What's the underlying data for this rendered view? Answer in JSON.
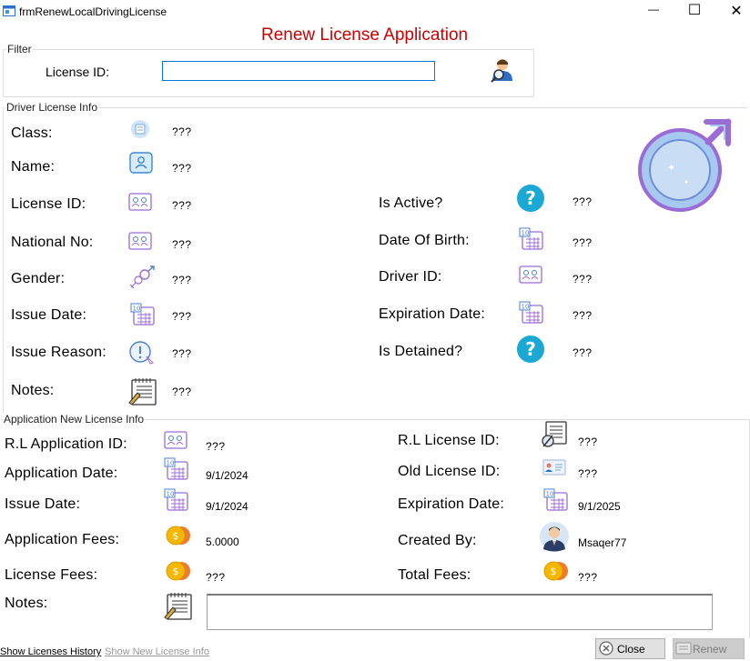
{
  "window": {
    "title": "frmRenewLocalDrivingLicense",
    "minimize": "—",
    "maximize": "☐",
    "close": "✕"
  },
  "form_title": "Renew License Application",
  "filter": {
    "caption": "Filter",
    "license_id_label": "License ID:",
    "license_id_value": ""
  },
  "driver_info": {
    "caption": "Driver License Info",
    "class": {
      "label": "Class:",
      "value": "???"
    },
    "name": {
      "label": "Name:",
      "value": "???"
    },
    "license_id": {
      "label": "License ID:",
      "value": "???"
    },
    "national_no": {
      "label": "National No:",
      "value": "???"
    },
    "gender": {
      "label": "Gender:",
      "value": "???"
    },
    "issue_date": {
      "label": "Issue Date:",
      "value": "???"
    },
    "issue_reason": {
      "label": "Issue Reason:",
      "value": "???"
    },
    "notes": {
      "label": "Notes:",
      "value": "???"
    },
    "is_active": {
      "label": "Is Active?",
      "value": "???"
    },
    "date_of_birth": {
      "label": "Date Of Birth:",
      "value": "???"
    },
    "driver_id": {
      "label": "Driver ID:",
      "value": "???"
    },
    "expiration_date": {
      "label": "Expiration Date:",
      "value": "???"
    },
    "is_detained": {
      "label": "Is Detained?",
      "value": "???"
    }
  },
  "application_info": {
    "caption": "Application New License Info",
    "rl_application_id": {
      "label": "R.L Application ID:",
      "value": "???"
    },
    "application_date": {
      "label": "Application Date:",
      "value": "9/1/2024"
    },
    "issue_date": {
      "label": "Issue Date:",
      "value": "9/1/2024"
    },
    "application_fees": {
      "label": "Application Fees:",
      "value": "5.0000"
    },
    "license_fees": {
      "label": "License Fees:",
      "value": "???"
    },
    "notes": {
      "label": "Notes:",
      "value": ""
    },
    "rl_license_id": {
      "label": "R.L License ID:",
      "value": "???"
    },
    "old_license_id": {
      "label": "Old License ID:",
      "value": "???"
    },
    "expiration_date": {
      "label": "Expiration Date:",
      "value": "9/1/2025"
    },
    "created_by": {
      "label": "Created By:",
      "value": "Msaqer77"
    },
    "total_fees": {
      "label": "Total Fees:",
      "value": "???"
    }
  },
  "footer": {
    "show_history": "Show Licenses History",
    "show_new_info": "Show New License Info",
    "close_button": "Close",
    "renew_button": "Renew"
  },
  "colors": {
    "title_red": "#cc0000",
    "accent_blue": "#0078d7",
    "help_cyan": "#1ba8d5",
    "icon_purple": "#9b6bd6",
    "coin_gold": "#f5b800"
  }
}
